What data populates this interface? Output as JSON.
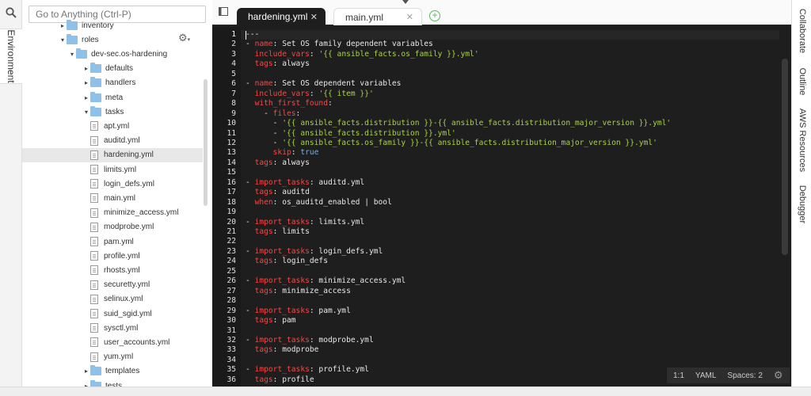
{
  "left_strip": {
    "environment_label": "Environment"
  },
  "tree": {
    "goto_placeholder": "Go to Anything (Ctrl-P)",
    "rows": [
      {
        "label": "inventory",
        "kind": "folder",
        "arrow": "▸",
        "indent": 46
      },
      {
        "label": "roles",
        "kind": "folder",
        "arrow": "▾",
        "indent": 46
      },
      {
        "label": "dev-sec.os-hardening",
        "kind": "folder",
        "arrow": "▾",
        "indent": 58
      },
      {
        "label": "defaults",
        "kind": "folder",
        "arrow": "▸",
        "indent": 76
      },
      {
        "label": "handlers",
        "kind": "folder",
        "arrow": "▸",
        "indent": 76
      },
      {
        "label": "meta",
        "kind": "folder",
        "arrow": "▸",
        "indent": 76
      },
      {
        "label": "tasks",
        "kind": "folder",
        "arrow": "▾",
        "indent": 76
      },
      {
        "label": "apt.yml",
        "kind": "file"
      },
      {
        "label": "auditd.yml",
        "kind": "file"
      },
      {
        "label": "hardening.yml",
        "kind": "file",
        "selected": true
      },
      {
        "label": "limits.yml",
        "kind": "file"
      },
      {
        "label": "login_defs.yml",
        "kind": "file"
      },
      {
        "label": "main.yml",
        "kind": "file"
      },
      {
        "label": "minimize_access.yml",
        "kind": "file"
      },
      {
        "label": "modprobe.yml",
        "kind": "file"
      },
      {
        "label": "pam.yml",
        "kind": "file"
      },
      {
        "label": "profile.yml",
        "kind": "file"
      },
      {
        "label": "rhosts.yml",
        "kind": "file"
      },
      {
        "label": "securetty.yml",
        "kind": "file"
      },
      {
        "label": "selinux.yml",
        "kind": "file"
      },
      {
        "label": "suid_sgid.yml",
        "kind": "file"
      },
      {
        "label": "sysctl.yml",
        "kind": "file"
      },
      {
        "label": "user_accounts.yml",
        "kind": "file"
      },
      {
        "label": "yum.yml",
        "kind": "file"
      },
      {
        "label": "templates",
        "kind": "folder",
        "arrow": "▸",
        "indent": 76
      },
      {
        "label": "tests",
        "kind": "folder",
        "arrow": "▸",
        "indent": 76
      }
    ]
  },
  "tabs": [
    {
      "label": "hardening.yml",
      "active": true
    },
    {
      "label": "main.yml",
      "active": false
    }
  ],
  "code_lines": [
    "---",
    "- <k>name</k>: Set OS family dependent variables",
    "  <k>include_vars</k>: <s>'{{ ansible_facts.os_family }}.yml'</s>",
    "  <k>tags</k>: always",
    "",
    "- <k>name</k>: Set OS dependent variables",
    "  <k>include_vars</k>: <s>'{{ item }}'</s>",
    "  <k>with_first_found</k>:",
    "    - <k>files</k>:",
    "      - <s>'{{ ansible_facts.distribution }}-{{ ansible_facts.distribution_major_version }}.yml'</s>",
    "      - <s>'{{ ansible_facts.distribution }}.yml'</s>",
    "      - <s>'{{ ansible_facts.os_family }}-{{ ansible_facts.distribution_major_version }}.yml'</s>",
    "      <k>skip</k>: <b>true</b>",
    "  <k>tags</k>: always",
    "",
    "- <k>import_tasks</k>: auditd.yml",
    "  <k>tags</k>: auditd",
    "  <k>when</k>: os_auditd_enabled | bool",
    "",
    "- <k>import_tasks</k>: limits.yml",
    "  <k>tags</k>: limits",
    "",
    "- <k>import_tasks</k>: login_defs.yml",
    "  <k>tags</k>: login_defs",
    "",
    "- <k>import_tasks</k>: minimize_access.yml",
    "  <k>tags</k>: minimize_access",
    "",
    "- <k>import_tasks</k>: pam.yml",
    "  <k>tags</k>: pam",
    "",
    "- <k>import_tasks</k>: modprobe.yml",
    "  <k>tags</k>: modprobe",
    "",
    "- <k>import_tasks</k>: profile.yml",
    "  <k>tags</k>: profile"
  ],
  "status": {
    "position": "1:1",
    "mode": "YAML",
    "spaces": "Spaces: 2"
  },
  "right_tabs": [
    "Collaborate",
    "Outline",
    "AWS Resources",
    "Debugger"
  ],
  "colors": {
    "keyword": "#f44848",
    "string": "#a6d14a",
    "boolean": "#6fb0e8",
    "folder": "#8ec0e8"
  }
}
